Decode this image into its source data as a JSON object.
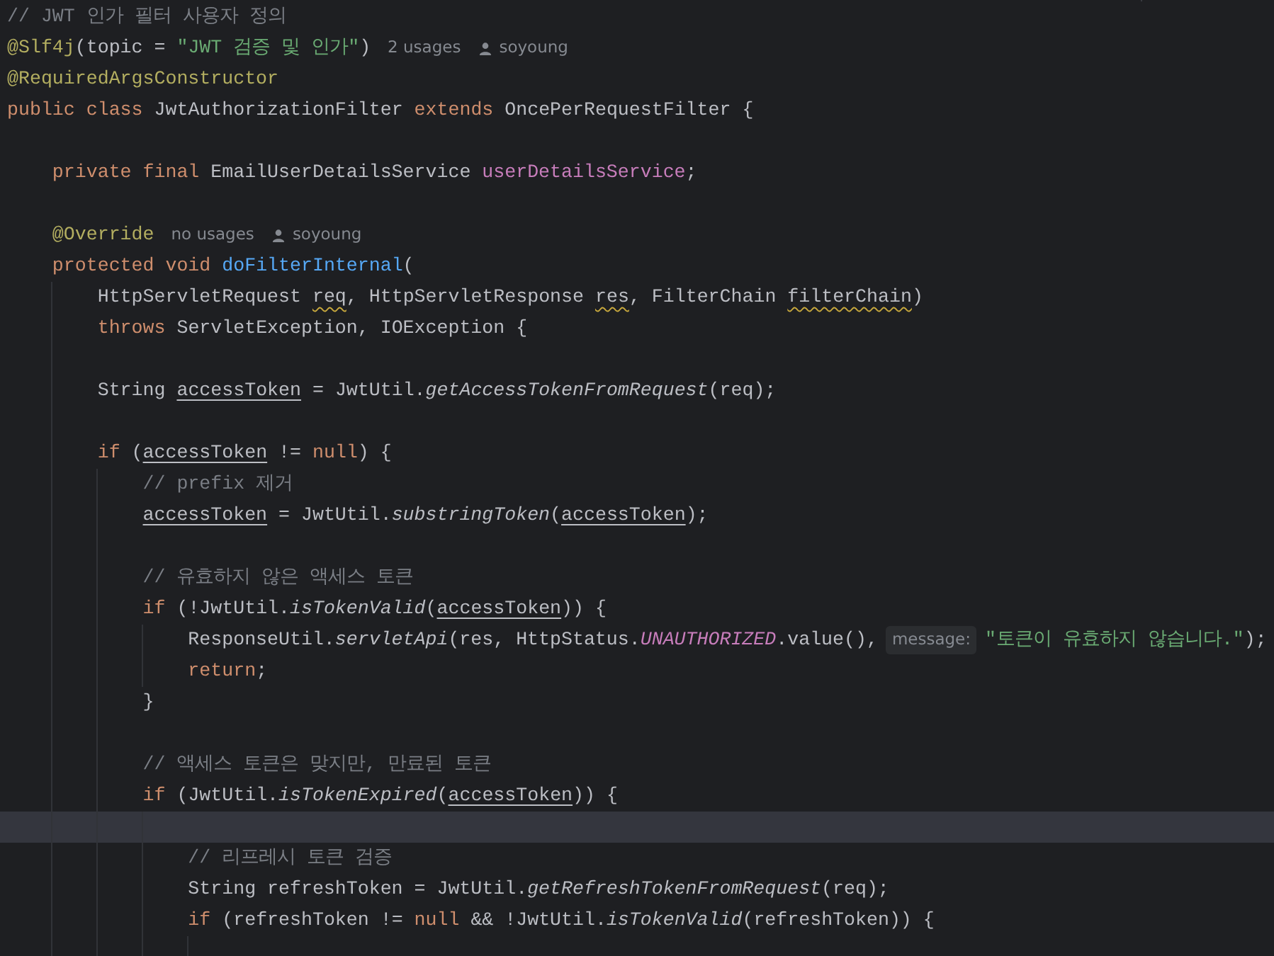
{
  "editor": {
    "lines": [
      {
        "current": false,
        "tokens": [
          {
            "kind": "comment",
            "text": "// JWT 인가 필터 사용자 정의"
          }
        ]
      },
      {
        "current": false,
        "tokens": [
          {
            "kind": "annotation",
            "text": "@Slf4j"
          },
          {
            "kind": "plain",
            "text": "(topic = "
          },
          {
            "kind": "string",
            "text": "\"JWT 검증 및 인가\""
          },
          {
            "kind": "plain",
            "text": ")"
          },
          {
            "kind": "usages",
            "text": "2 usages"
          },
          {
            "kind": "author",
            "text": "soyoung"
          }
        ]
      },
      {
        "current": false,
        "tokens": [
          {
            "kind": "annotation",
            "text": "@RequiredArgsConstructor"
          }
        ]
      },
      {
        "current": false,
        "tokens": [
          {
            "kind": "keyword",
            "text": "public class"
          },
          {
            "kind": "plain",
            "text": " JwtAuthorizationFilter "
          },
          {
            "kind": "keyword",
            "text": "extends"
          },
          {
            "kind": "plain",
            "text": " OncePerRequestFilter {"
          }
        ]
      },
      {
        "current": false
      },
      {
        "current": false,
        "tokens": [
          {
            "kind": "keyword",
            "text": "    private final"
          },
          {
            "kind": "plain",
            "text": " EmailUserDetailsService "
          },
          {
            "kind": "field",
            "text": "userDetailsService"
          },
          {
            "kind": "plain",
            "text": ";"
          }
        ]
      },
      {
        "current": false
      },
      {
        "current": false,
        "tokens": [
          {
            "kind": "annotation",
            "text": "    @Override"
          },
          {
            "kind": "usages",
            "text": "no usages"
          },
          {
            "kind": "author",
            "text": "soyoung"
          }
        ]
      },
      {
        "current": false,
        "tokens": [
          {
            "kind": "keyword",
            "text": "    protected void"
          },
          {
            "kind": "method_decl",
            "text": " doFilterInternal"
          },
          {
            "kind": "plain",
            "text": "("
          }
        ]
      },
      {
        "current": false,
        "tokens": [
          {
            "kind": "plain",
            "text": "        HttpServletRequest "
          },
          {
            "kind": "warn",
            "text": "req"
          },
          {
            "kind": "plain",
            "text": ", HttpServletResponse "
          },
          {
            "kind": "warn",
            "text": "res"
          },
          {
            "kind": "plain",
            "text": ", FilterChain "
          },
          {
            "kind": "warn",
            "text": "filterChain"
          },
          {
            "kind": "plain",
            "text": ")"
          }
        ]
      },
      {
        "current": false,
        "tokens": [
          {
            "kind": "keyword",
            "text": "        throws"
          },
          {
            "kind": "plain",
            "text": " ServletException, IOException {"
          }
        ]
      },
      {
        "current": false
      },
      {
        "current": false,
        "tokens": [
          {
            "kind": "plain",
            "text": "        String "
          },
          {
            "kind": "ref",
            "text": "accessToken"
          },
          {
            "kind": "plain",
            "text": " = JwtUtil."
          },
          {
            "kind": "static",
            "text": "getAccessTokenFromRequest"
          },
          {
            "kind": "plain",
            "text": "(req);"
          }
        ]
      },
      {
        "current": false
      },
      {
        "current": false,
        "tokens": [
          {
            "kind": "keyword",
            "text": "        if"
          },
          {
            "kind": "plain",
            "text": " ("
          },
          {
            "kind": "ref",
            "text": "accessToken"
          },
          {
            "kind": "plain",
            "text": " != "
          },
          {
            "kind": "keyword",
            "text": "null"
          },
          {
            "kind": "plain",
            "text": ") {"
          }
        ]
      },
      {
        "current": false,
        "tokens": [
          {
            "kind": "comment",
            "text": "            // prefix 제거"
          }
        ]
      },
      {
        "current": false,
        "tokens": [
          {
            "kind": "ref",
            "text": "            accessToken"
          },
          {
            "kind": "plain",
            "text": " = JwtUtil."
          },
          {
            "kind": "static",
            "text": "substringToken"
          },
          {
            "kind": "plain",
            "text": "("
          },
          {
            "kind": "ref",
            "text": "accessToken"
          },
          {
            "kind": "plain",
            "text": ");"
          }
        ]
      },
      {
        "current": false
      },
      {
        "current": false,
        "tokens": [
          {
            "kind": "comment",
            "text": "            // 유효하지 않은 액세스 토큰"
          }
        ]
      },
      {
        "current": false,
        "tokens": [
          {
            "kind": "keyword",
            "text": "            if"
          },
          {
            "kind": "plain",
            "text": " (!JwtUtil."
          },
          {
            "kind": "static",
            "text": "isTokenValid"
          },
          {
            "kind": "plain",
            "text": "("
          },
          {
            "kind": "ref",
            "text": "accessToken"
          },
          {
            "kind": "plain",
            "text": ")) {"
          }
        ]
      },
      {
        "current": false,
        "tokens": [
          {
            "kind": "plain",
            "text": "                ResponseUtil."
          },
          {
            "kind": "static",
            "text": "servletApi"
          },
          {
            "kind": "plain",
            "text": "(res, HttpStatus."
          },
          {
            "kind": "constant",
            "text": "UNAUTHORIZED"
          },
          {
            "kind": "plain",
            "text": ".value(),"
          },
          {
            "kind": "param_hint",
            "text": "message:"
          },
          {
            "kind": "string",
            "text": "\"토큰이 유효하지 않습니다.\""
          },
          {
            "kind": "plain",
            "text": ");"
          }
        ]
      },
      {
        "current": false,
        "tokens": [
          {
            "kind": "keyword",
            "text": "                return"
          },
          {
            "kind": "plain",
            "text": ";"
          }
        ]
      },
      {
        "current": false,
        "tokens": [
          {
            "kind": "plain",
            "text": "            }"
          }
        ]
      },
      {
        "current": false
      },
      {
        "current": false,
        "tokens": [
          {
            "kind": "comment",
            "text": "            // 액세스 토큰은 맞지만, 만료된 토큰"
          }
        ]
      },
      {
        "current": false,
        "tokens": [
          {
            "kind": "keyword",
            "text": "            if"
          },
          {
            "kind": "plain",
            "text": " (JwtUtil."
          },
          {
            "kind": "static",
            "text": "isTokenExpired"
          },
          {
            "kind": "plain",
            "text": "("
          },
          {
            "kind": "ref",
            "text": "accessToken"
          },
          {
            "kind": "plain",
            "text": ")) {"
          }
        ]
      },
      {
        "current": true
      },
      {
        "current": false,
        "tokens": [
          {
            "kind": "comment",
            "text": "                // 리프레시 토큰 검증"
          }
        ]
      },
      {
        "current": false,
        "tokens": [
          {
            "kind": "plain",
            "text": "                String refreshToken = JwtUtil."
          },
          {
            "kind": "static",
            "text": "getRefreshTokenFromRequest"
          },
          {
            "kind": "plain",
            "text": "(req);"
          }
        ]
      },
      {
        "current": false,
        "tokens": [
          {
            "kind": "keyword",
            "text": "                if"
          },
          {
            "kind": "plain",
            "text": " (refreshToken != "
          },
          {
            "kind": "keyword",
            "text": "null"
          },
          {
            "kind": "plain",
            "text": " && !JwtUtil."
          },
          {
            "kind": "static",
            "text": "isTokenValid"
          },
          {
            "kind": "plain",
            "text": "(refreshToken)) {"
          }
        ]
      },
      {
        "current": false
      }
    ]
  }
}
